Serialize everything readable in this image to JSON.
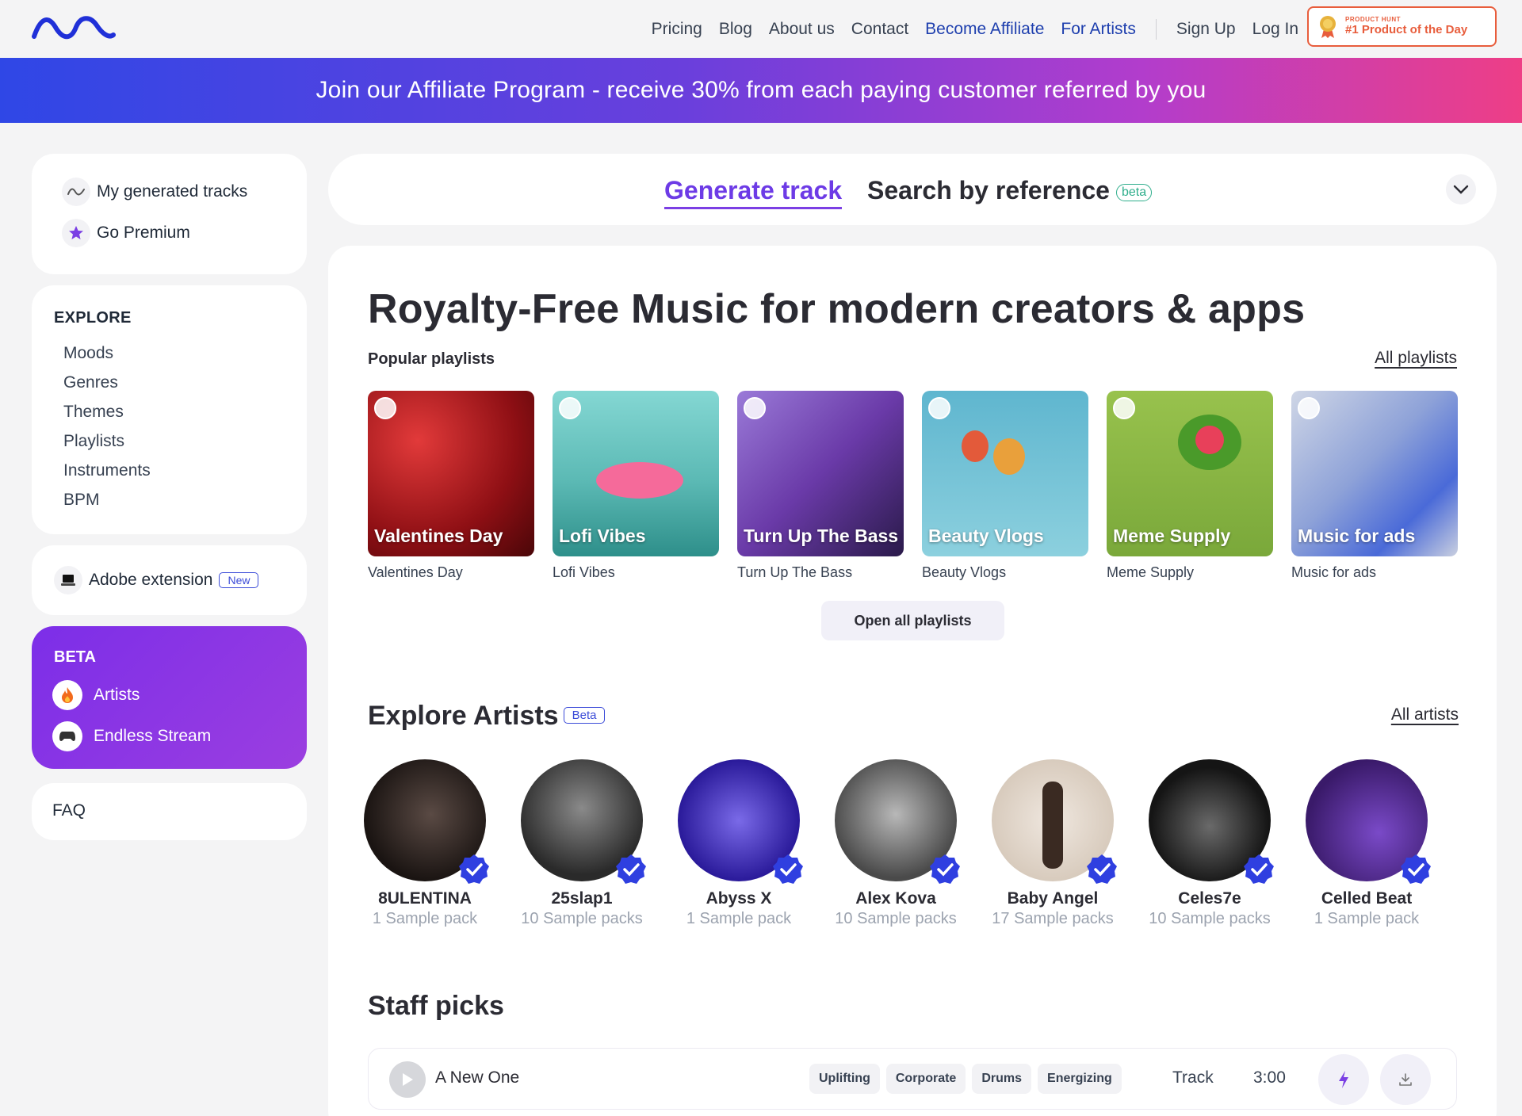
{
  "header": {
    "nav": [
      "Pricing",
      "Blog",
      "About us",
      "Contact",
      "Become Affiliate",
      "For Artists",
      "Sign Up",
      "Log In"
    ],
    "badge_small": "PRODUCT HUNT",
    "badge_big": "#1 Product of the Day"
  },
  "banner": {
    "text": "Join our Affiliate Program - receive 30% from each paying customer referred by you"
  },
  "sidebar": {
    "top": [
      {
        "label": "My generated tracks",
        "icon": "wave-icon"
      },
      {
        "label": "Go Premium",
        "icon": "star-icon"
      }
    ],
    "explore_title": "EXPLORE",
    "explore": [
      "Moods",
      "Genres",
      "Themes",
      "Playlists",
      "Instruments",
      "BPM"
    ],
    "adobe": {
      "label": "Adobe extension",
      "tag": "New"
    },
    "beta": {
      "title": "BETA",
      "items": [
        {
          "label": "Artists",
          "icon": "fire-icon"
        },
        {
          "label": "Endless Stream",
          "icon": "gamepad-icon"
        }
      ]
    },
    "faq": "FAQ"
  },
  "tabs": {
    "generate": "Generate track",
    "reference": "Search by reference",
    "reference_tag": "beta"
  },
  "main": {
    "headline": "Royalty-Free Music for modern creators & apps",
    "popular_title": "Popular playlists",
    "all_playlists": "All playlists",
    "playlists": [
      {
        "title": "Valentines Day",
        "caption": "Valentines Day"
      },
      {
        "title": "Lofi Vibes",
        "caption": "Lofi Vibes"
      },
      {
        "title": "Turn Up The Bass",
        "caption": "Turn Up The Bass"
      },
      {
        "title": "Beauty Vlogs",
        "caption": "Beauty Vlogs"
      },
      {
        "title": "Meme Supply",
        "caption": "Meme Supply"
      },
      {
        "title": "Music for ads",
        "caption": "Music for ads"
      }
    ],
    "open_all": "Open all playlists",
    "artists_title": "Explore Artists",
    "artists_tag": "Beta",
    "all_artists": "All artists",
    "artists": [
      {
        "name": "8ULENTINA",
        "packs": "1 Sample pack"
      },
      {
        "name": "25slap1",
        "packs": "10 Sample packs"
      },
      {
        "name": "Abyss X",
        "packs": "1 Sample pack"
      },
      {
        "name": "Alex Kova",
        "packs": "10 Sample packs"
      },
      {
        "name": "Baby Angel",
        "packs": "17 Sample packs"
      },
      {
        "name": "Celes7e",
        "packs": "10 Sample packs"
      },
      {
        "name": "Celled Beat",
        "packs": "1 Sample pack"
      }
    ],
    "staff_title": "Staff picks",
    "track": {
      "name": "A New One",
      "tags": [
        "Uplifting",
        "Corporate",
        "Drums",
        "Energizing"
      ],
      "type": "Track",
      "duration": "3:00"
    }
  },
  "colors": {
    "accent": "#6d3be6",
    "nav_blue": "#1e3fae",
    "ph_orange": "#e85d3c",
    "verified": "#2f3fe0"
  }
}
